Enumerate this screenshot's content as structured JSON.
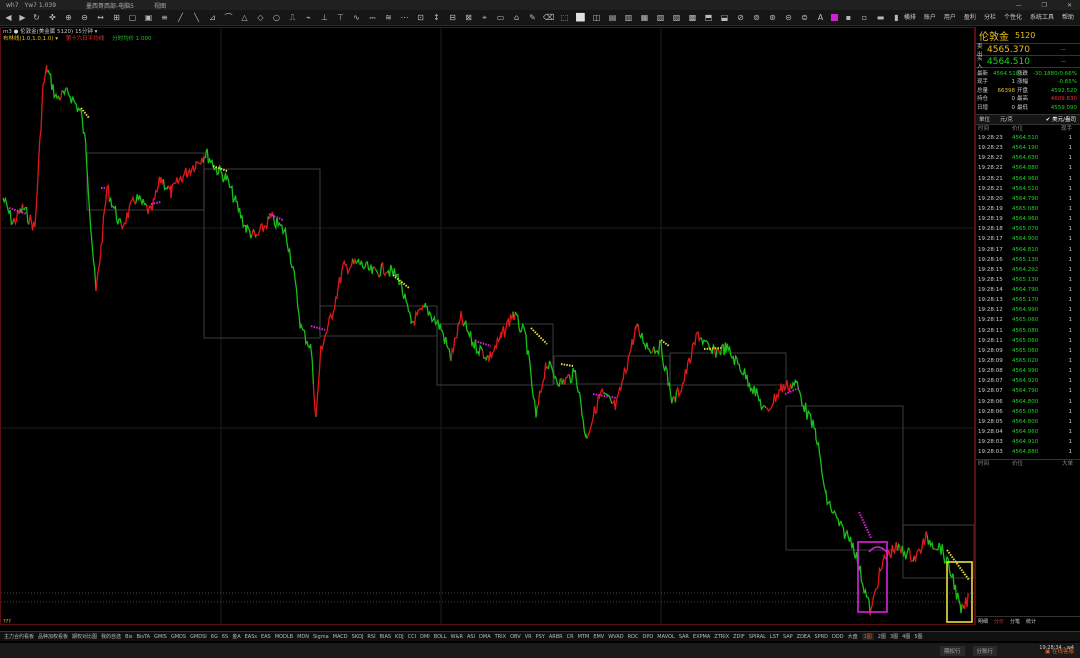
{
  "titlebar": {
    "items": [
      "wh7",
      "Yw7 1.039",
      "墨西哥西部-电脑5",
      "视图"
    ],
    "controls": [
      "—",
      "❐",
      "✕"
    ]
  },
  "topmenu": [
    "横排",
    "账户",
    "用户",
    "盈利",
    "分栏",
    "个性化",
    "系统工具",
    "帮助"
  ],
  "chart": {
    "header_line1": "m3 ● 伦敦金(美金属 5120)  15分钟 ▾",
    "header_line2": [
      {
        "text": "布林线(1.0,1.0,1.0) ▾",
        "color": "#e8c020"
      },
      {
        "text": "第十六日平均线",
        "color": "#e03030"
      },
      {
        "text": "分时均价 1.000",
        "color": "#20c020"
      }
    ],
    "corner_label": "???",
    "colors": {
      "up": "#e01818",
      "down": "#18c018",
      "frame": "#5a1010",
      "highlight_magenta": "#e020e0",
      "highlight_yellow": "#e8e040",
      "boxes": "#555555"
    }
  },
  "quote": {
    "name": "伦敦金",
    "code": "5120",
    "sell_label": "卖出",
    "sell_price": "4565.370",
    "buy_label": "买入",
    "buy_price": "4564.510",
    "dash": "—",
    "grid": [
      {
        "l1": "最新",
        "v1": "4564.510",
        "l2": "涨跌",
        "v2": "-30.1880/0.66%",
        "c1": "#20d020",
        "c2": "#20d020"
      },
      {
        "l1": "现手",
        "v1": "1",
        "l2": "涨幅",
        "v2": "-0.65%",
        "c1": "#cccccc",
        "c2": "#20d020"
      },
      {
        "l1": "总量",
        "v1": "66398",
        "l2": "开盘",
        "v2": "4592.520",
        "c1": "#e8c020",
        "c2": "#20d020"
      },
      {
        "l1": "持仓",
        "v1": "0",
        "l2": "最高",
        "v2": "4609.830",
        "c1": "#cccccc",
        "c2": "#e03030"
      },
      {
        "l1": "日增",
        "v1": "0",
        "l2": "最低",
        "v2": "4559.090",
        "c1": "#cccccc",
        "c2": "#20d020"
      }
    ],
    "tabs": [
      "单位",
      "元/克",
      "✔ 美元/盎司"
    ]
  },
  "ticks": {
    "headers": [
      "时间",
      "价位",
      "现手"
    ],
    "rows": [
      [
        "19:28:23",
        "4564.510",
        "1"
      ],
      [
        "19:28:23",
        "4564.190",
        "1"
      ],
      [
        "19:28:22",
        "4564.630",
        "1"
      ],
      [
        "19:28:22",
        "4564.880",
        "1"
      ],
      [
        "19:28:21",
        "4564.960",
        "1"
      ],
      [
        "19:28:21",
        "4564.510",
        "1"
      ],
      [
        "19:28:20",
        "4564.790",
        "1"
      ],
      [
        "19:28:19",
        "4565.080",
        "1"
      ],
      [
        "19:28:19",
        "4564.960",
        "1"
      ],
      [
        "19:28:18",
        "4565.070",
        "1"
      ],
      [
        "19:28:17",
        "4564.900",
        "1"
      ],
      [
        "19:28:17",
        "4564.810",
        "1"
      ],
      [
        "19:28:16",
        "4565.130",
        "1"
      ],
      [
        "19:28:15",
        "4564.292",
        "1"
      ],
      [
        "19:28:15",
        "4565.130",
        "1"
      ],
      [
        "19:28:14",
        "4564.790",
        "1"
      ],
      [
        "19:28:13",
        "4565.170",
        "1"
      ],
      [
        "19:28:12",
        "4564.990",
        "1"
      ],
      [
        "19:28:12",
        "4565.060",
        "1"
      ],
      [
        "19:28:11",
        "4565.080",
        "1"
      ],
      [
        "19:28:11",
        "4565.060",
        "1"
      ],
      [
        "19:28:09",
        "4565.060",
        "1"
      ],
      [
        "19:28:09",
        "4565.020",
        "1"
      ],
      [
        "19:28:08",
        "4564.990",
        "1"
      ],
      [
        "19:28:07",
        "4564.920",
        "1"
      ],
      [
        "19:28:07",
        "4564.790",
        "1"
      ],
      [
        "19:28:06",
        "4564.800",
        "1"
      ],
      [
        "19:28:06",
        "4565.050",
        "1"
      ],
      [
        "19:28:05",
        "4564.800",
        "1"
      ],
      [
        "19:28:04",
        "4564.960",
        "1"
      ],
      [
        "19:28:03",
        "4564.910",
        "1"
      ],
      [
        "19:28:03",
        "4564.880",
        "1"
      ]
    ],
    "bottom_headers": [
      "时间",
      "价位",
      "大单"
    ],
    "footer": [
      "明细",
      "分价",
      "分笔",
      "统计"
    ]
  },
  "bottom_tabs": [
    "主力合约看板",
    "品种加权看板",
    "期权对比图",
    "我的自选",
    "Bis",
    "BisTA",
    "GMIS",
    "GMDS",
    "GMDSI",
    "6G",
    "6S",
    "金A",
    "EASs",
    "EAS",
    "MODLB",
    "MDN",
    "Sigma",
    "MACD",
    "SKDJ",
    "RSI",
    "BIAS",
    "KDJ",
    "CCI",
    "DMI",
    "BOLL",
    "W&R",
    "ASI",
    "DMA",
    "TRIX",
    "OBV",
    "VR",
    "PSY",
    "ARBR",
    "CR",
    "MTM",
    "EMV",
    "WVAD",
    "ROC",
    "DPO",
    "MAVOL",
    "SAR",
    "EXPMA",
    "ZTRIX",
    "ZDIF",
    "SPIRAL",
    "LST",
    "SAP",
    "ZDEA",
    "SPRD",
    "DDD",
    "大盘",
    "2图",
    "3图",
    "4图",
    "5图"
  ],
  "bottom_active": "1图",
  "status": {
    "btn1": "期权行",
    "btn2": "分账行",
    "logo": "▣ 在线客服",
    "time": "19:28:34 - w4"
  }
}
